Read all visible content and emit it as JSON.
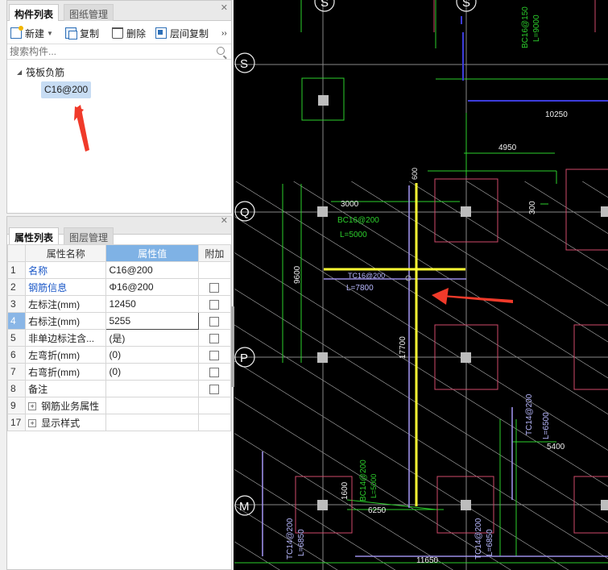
{
  "component_panel": {
    "tabs": [
      {
        "label": "构件列表",
        "active": true
      },
      {
        "label": "图纸管理",
        "active": false
      }
    ],
    "toolbar": {
      "new": "新建",
      "copy": "复制",
      "delete": "删除",
      "floor_copy": "层间复制",
      "more": "››"
    },
    "search_placeholder": "搜索构件...",
    "tree": {
      "root": "筏板负筋",
      "child": "C16@200"
    }
  },
  "property_panel": {
    "tabs": [
      {
        "label": "属性列表",
        "active": true
      },
      {
        "label": "图层管理",
        "active": false
      }
    ],
    "headers": {
      "name": "属性名称",
      "value": "属性值",
      "extra": "附加"
    },
    "rows": [
      {
        "num": "1",
        "name": "名称",
        "value": "C16@200",
        "blue": true,
        "checkbox": false
      },
      {
        "num": "2",
        "name": "钢筋信息",
        "value": "Φ16@200",
        "blue": true,
        "checkbox": true
      },
      {
        "num": "3",
        "name": "左标注(mm)",
        "value": "12450",
        "blue": false,
        "checkbox": true
      },
      {
        "num": "4",
        "name": "右标注(mm)",
        "value": "5255",
        "blue": false,
        "checkbox": true,
        "selected": true
      },
      {
        "num": "5",
        "name": "非单边标注含...",
        "value": "(是)",
        "blue": false,
        "checkbox": true
      },
      {
        "num": "6",
        "name": "左弯折(mm)",
        "value": "(0)",
        "blue": false,
        "checkbox": true
      },
      {
        "num": "7",
        "name": "右弯折(mm)",
        "value": "(0)",
        "blue": false,
        "checkbox": true
      },
      {
        "num": "8",
        "name": "备注",
        "value": "",
        "blue": false,
        "checkbox": true
      },
      {
        "num": "9",
        "name": "钢筋业务属性",
        "value": "",
        "blue": false,
        "checkbox": false,
        "group": true
      },
      {
        "num": "17",
        "name": "显示样式",
        "value": "",
        "blue": false,
        "checkbox": false,
        "group": true
      }
    ]
  },
  "cad": {
    "axis_labels": [
      "S",
      "S",
      "Q",
      "P",
      "M"
    ],
    "dimensions": [
      "10250",
      "4950",
      "3000",
      "300",
      "9600",
      "17700",
      "5400",
      "1600",
      "6250",
      "11650",
      "L=7800",
      "L=5000",
      "L=6500",
      "L=6850",
      "L=9000"
    ],
    "rebar_labels": [
      "TC16@200",
      "BC16@200",
      "TC14@200",
      "BC16@150",
      "TC14@200",
      "BC14@200"
    ]
  }
}
